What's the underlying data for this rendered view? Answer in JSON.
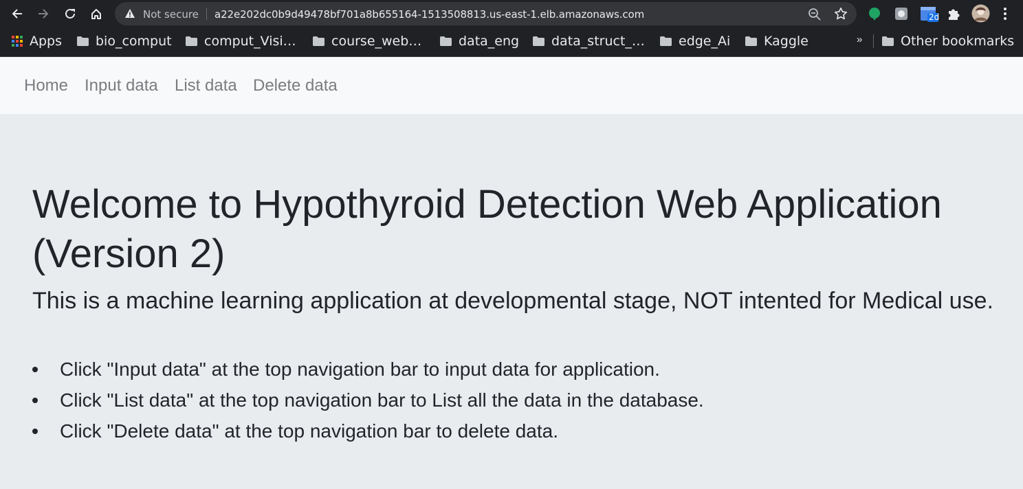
{
  "browser": {
    "security_label": "Not secure",
    "url": "a22e202dc0b9d49478bf701a8b655164-1513508813.us-east-1.elb.amazonaws.com",
    "extension_badge": "2d",
    "bookmarks": [
      {
        "label": "Apps",
        "icon": "apps-grid-icon"
      },
      {
        "label": "bio_comput",
        "icon": "folder-icon"
      },
      {
        "label": "comput_Visi…",
        "icon": "folder-icon"
      },
      {
        "label": "course_web…",
        "icon": "folder-icon"
      },
      {
        "label": "data_eng",
        "icon": "folder-icon"
      },
      {
        "label": "data_struct_…",
        "icon": "folder-icon"
      },
      {
        "label": "edge_Ai",
        "icon": "folder-icon"
      },
      {
        "label": "Kaggle",
        "icon": "folder-icon"
      }
    ],
    "overflow_label": "»",
    "other_bookmarks": "Other bookmarks"
  },
  "navbar": {
    "links": [
      "Home",
      "Input data",
      "List data",
      "Delete data"
    ]
  },
  "main": {
    "title": "Welcome to Hypothyroid Detection Web Application (Version 2)",
    "lead": "This is a machine learning application at developmental stage, NOT intented for Medical use.",
    "bullets": [
      "Click \"Input data\" at the top navigation bar to input data for application.",
      "Click \"List data\" at the top navigation bar to List all the data in the database.",
      "Click \"Delete data\" at the top navigation bar to delete data."
    ]
  },
  "colors": {
    "chrome_bg": "#202124",
    "omnibox_bg": "#35363a",
    "navbar_bg": "#f8f9fa",
    "jumbotron_bg": "#e9ecef",
    "nav_link": "#7a7d80",
    "text": "#212529"
  }
}
